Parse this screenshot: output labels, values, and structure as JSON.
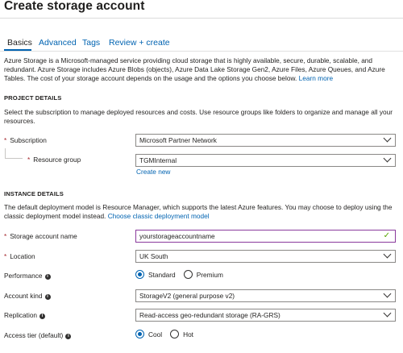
{
  "title": "Create storage account",
  "tabs": [
    {
      "label": "Basics"
    },
    {
      "label": "Advanced"
    },
    {
      "label": "Tags"
    },
    {
      "label": "Review + create"
    }
  ],
  "intro": {
    "text": "Azure Storage is a Microsoft-managed service providing cloud storage that is highly available, secure, durable, scalable, and redundant. Azure Storage includes Azure Blobs (objects), Azure Data Lake Storage Gen2, Azure Files, Azure Queues, and Azure Tables. The cost of your storage account depends on the usage and the options you choose below.",
    "link": "Learn more"
  },
  "project": {
    "heading": "PROJECT DETAILS",
    "desc": "Select the subscription to manage deployed resources and costs. Use resource groups like folders to organize and manage all your resources.",
    "subscription_label": "Subscription",
    "subscription_value": "Microsoft Partner Network",
    "rg_label": "Resource group",
    "rg_value": "TGMInternal",
    "create_new": "Create new"
  },
  "instance": {
    "heading": "INSTANCE DETAILS",
    "desc": "The default deployment model is Resource Manager, which supports the latest Azure features. You may choose to deploy using the classic deployment model instead.",
    "classic_link": "Choose classic deployment model",
    "name_label": "Storage account name",
    "name_value": "yourstorageaccountname",
    "location_label": "Location",
    "location_value": "UK South",
    "performance_label": "Performance",
    "performance_options": [
      "Standard",
      "Premium"
    ],
    "kind_label": "Account kind",
    "kind_value": "StorageV2 (general purpose v2)",
    "replication_label": "Replication",
    "replication_value": "Read-access geo-redundant storage (RA-GRS)",
    "access_label": "Access tier (default)",
    "access_options": [
      "Cool",
      "Hot"
    ]
  },
  "icons": {
    "required": "*",
    "info": "i",
    "check": "✓"
  },
  "colors": {
    "link": "#0063b1",
    "required": "#a4262c",
    "success": "#57a300",
    "focus_border": "#8a3a9c"
  }
}
